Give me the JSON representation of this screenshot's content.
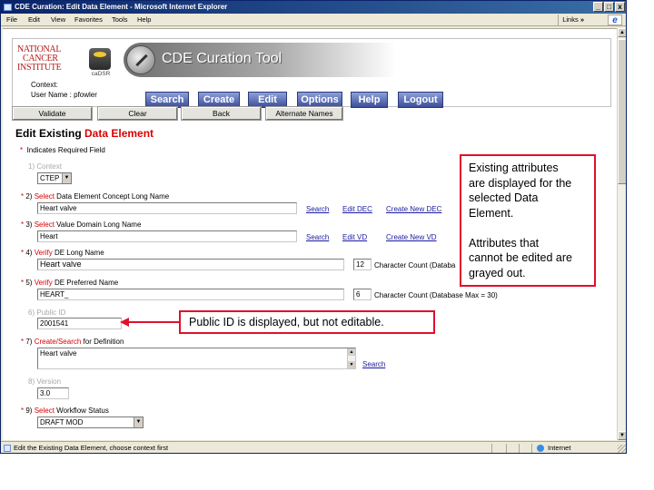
{
  "window": {
    "title": "CDE Curation: Edit Data Element - Microsoft Internet Explorer",
    "controls": [
      "_",
      "̲",
      "x"
    ]
  },
  "menu": {
    "items": [
      "File",
      "Edit",
      "View",
      "Favorites",
      "Tools",
      "Help"
    ],
    "links_label": "Links",
    "chevron": "»"
  },
  "banner": {
    "org_line1": "NATIONAL",
    "org_line2": "CANCER",
    "org_line3": "INSTITUTE",
    "cadsr_label": "caDSR",
    "tool_title": "CDE Curation Tool",
    "context_label": "Context:",
    "user_label": "User Name : pfowler",
    "nav": [
      "Search",
      "Create",
      "Edit",
      "Options",
      "Help",
      "Logout"
    ]
  },
  "actions": [
    "Validate",
    "Clear",
    "Back",
    "Alternate Names"
  ],
  "page": {
    "title_prefix": "Edit Existing ",
    "title_highlight": "Data Element",
    "required_note": "Indicates Required Field"
  },
  "form": {
    "context": {
      "num": "1)",
      "label": "Context",
      "value": "CTEP"
    },
    "dec": {
      "num": "2)",
      "verb": "Select",
      "label": " Data Element Concept Long Name",
      "value": "Heart valve",
      "links": [
        "Search",
        "Edit DEC",
        "Create New DEC"
      ]
    },
    "vd": {
      "num": "3)",
      "verb": "Select",
      "label": " Value Domain Long Name",
      "value": "Heart",
      "links": [
        "Search",
        "Edit VD",
        "Create New VD"
      ]
    },
    "long_name": {
      "num": "4)",
      "verb": "Verify",
      "label": " DE Long Name",
      "value": "Heart  valve",
      "count": "12",
      "count_label": "Character Count  (Databa"
    },
    "pref_name": {
      "num": "5)",
      "verb": "Verify",
      "label": " DE Preferred Name",
      "value": "HEART_",
      "count": "6",
      "count_label": "Character Count  (Database Max = 30)"
    },
    "public_id": {
      "num": "6)",
      "label": "Public ID",
      "value": "2001541"
    },
    "definition": {
      "num": "7)",
      "verb": "Create/Search",
      "label": " for Definition",
      "value": "Heart valve",
      "link": "Search"
    },
    "version": {
      "num": "8)",
      "label": "Version",
      "value": "3.0"
    },
    "workflow": {
      "num": "9)",
      "verb": "Select",
      "label": " Workflow Status",
      "value": "DRAFT MOD"
    }
  },
  "callouts": {
    "attrs_line1": "Existing attributes",
    "attrs_line2": "are displayed for the",
    "attrs_line3": "selected Data",
    "attrs_line4": "Element.",
    "attrs_line5": "Attributes that",
    "attrs_line6": "cannot be edited are",
    "attrs_line7": "grayed out.",
    "public_id_note": "Public ID is displayed, but not editable."
  },
  "status": {
    "text": "Edit the Existing Data Element, choose context first",
    "zone": "Internet"
  },
  "colors": {
    "required": "#d90000",
    "callout_border": "#e0102a",
    "nav_button": "#3b4e9a",
    "link": "#1a1aa0",
    "disabled_label": "#a8a8a8"
  }
}
